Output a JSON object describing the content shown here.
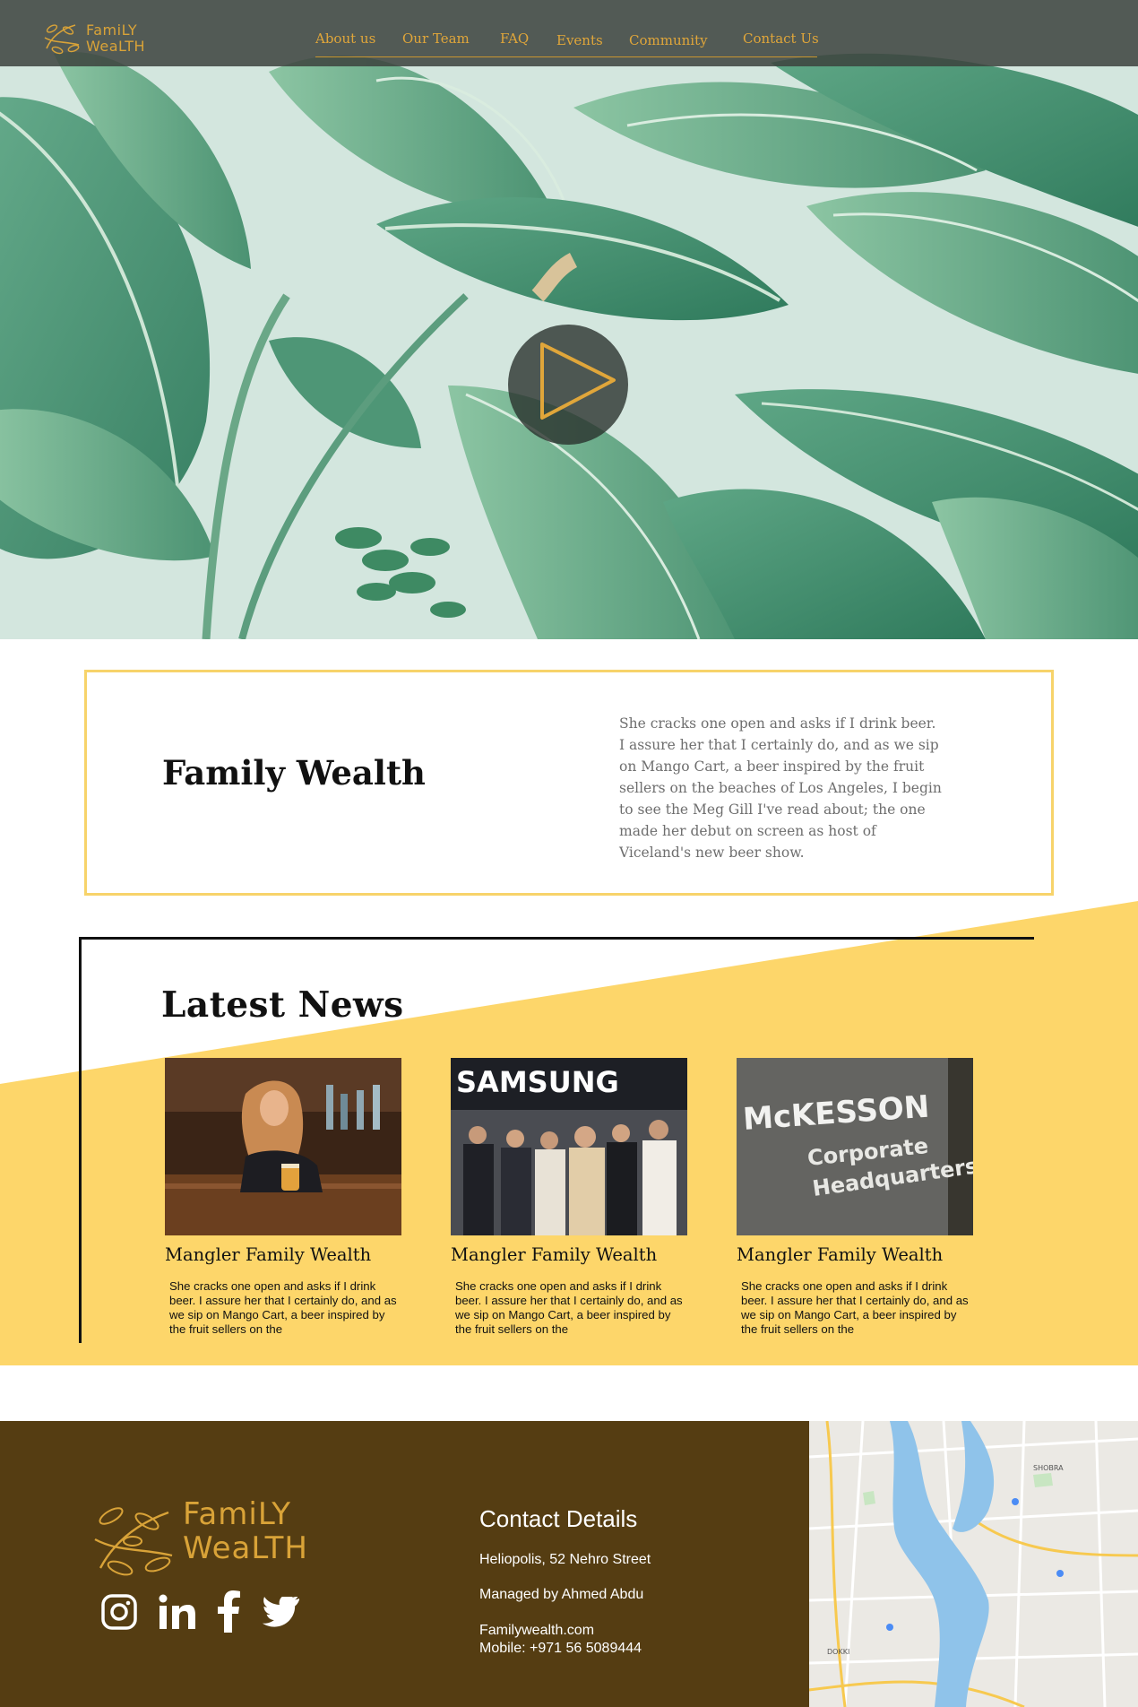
{
  "brand": {
    "line1": "FamiLY",
    "line2": "WeaLTH"
  },
  "nav": {
    "items": [
      {
        "label": "About us"
      },
      {
        "label": "Our Team"
      },
      {
        "label": "FAQ"
      },
      {
        "label": "Events"
      },
      {
        "label": "Community"
      },
      {
        "label": "Contact Us"
      }
    ]
  },
  "hero": {
    "play_icon": "play-icon"
  },
  "intro": {
    "title": "Family Wealth",
    "text": "She cracks one open and asks if I drink beer. I assure her that I certainly do, and as we sip on Mango Cart, a beer inspired by the fruit sellers on the beaches of Los Angeles, I begin to see the Meg Gill I've read about; the one made her debut on screen as host of Viceland's new beer show."
  },
  "news": {
    "title": "Latest News",
    "cards": [
      {
        "title": "Mangler Family Wealth",
        "text": "She cracks one open and asks if I drink beer. I assure her that I certainly do, and as we sip on Mango Cart, a beer inspired by the fruit sellers on the"
      },
      {
        "title": "Mangler Family Wealth",
        "text": "She cracks one open and asks if I drink beer. I assure her that I certainly do, and as we sip on Mango Cart, a beer inspired by the fruit sellers on the",
        "photo_sign": "SAMSUNG"
      },
      {
        "title": "Mangler Family Wealth",
        "text": "She cracks one open and asks if I drink beer. I assure her that I certainly do, and as we sip on Mango Cart, a beer inspired by the fruit sellers on the",
        "photo_sign_1": "McKESSON",
        "photo_sign_2": "Corporate",
        "photo_sign_3": "Headquarters"
      }
    ]
  },
  "footer": {
    "logo_line1": "FamiLY",
    "logo_line2": "WeaLTH",
    "socials": [
      "instagram-icon",
      "linkedin-icon",
      "facebook-icon",
      "twitter-icon"
    ],
    "contact_title": "Contact Details",
    "address": "Heliopolis, 52 Nehro Street",
    "manager": "Managed by Ahmed Abdu",
    "website": "Familywealth.com",
    "mobile": "Mobile: +971 56 5089444"
  },
  "map": {
    "labels": [
      "SHOBRA",
      "DOKKI"
    ]
  },
  "colors": {
    "gold": "#d9a338",
    "yellow": "#fdd66a",
    "footer_brown": "#553d12",
    "hero_bg": "#d3e6de",
    "river": "#8fc3ea"
  }
}
